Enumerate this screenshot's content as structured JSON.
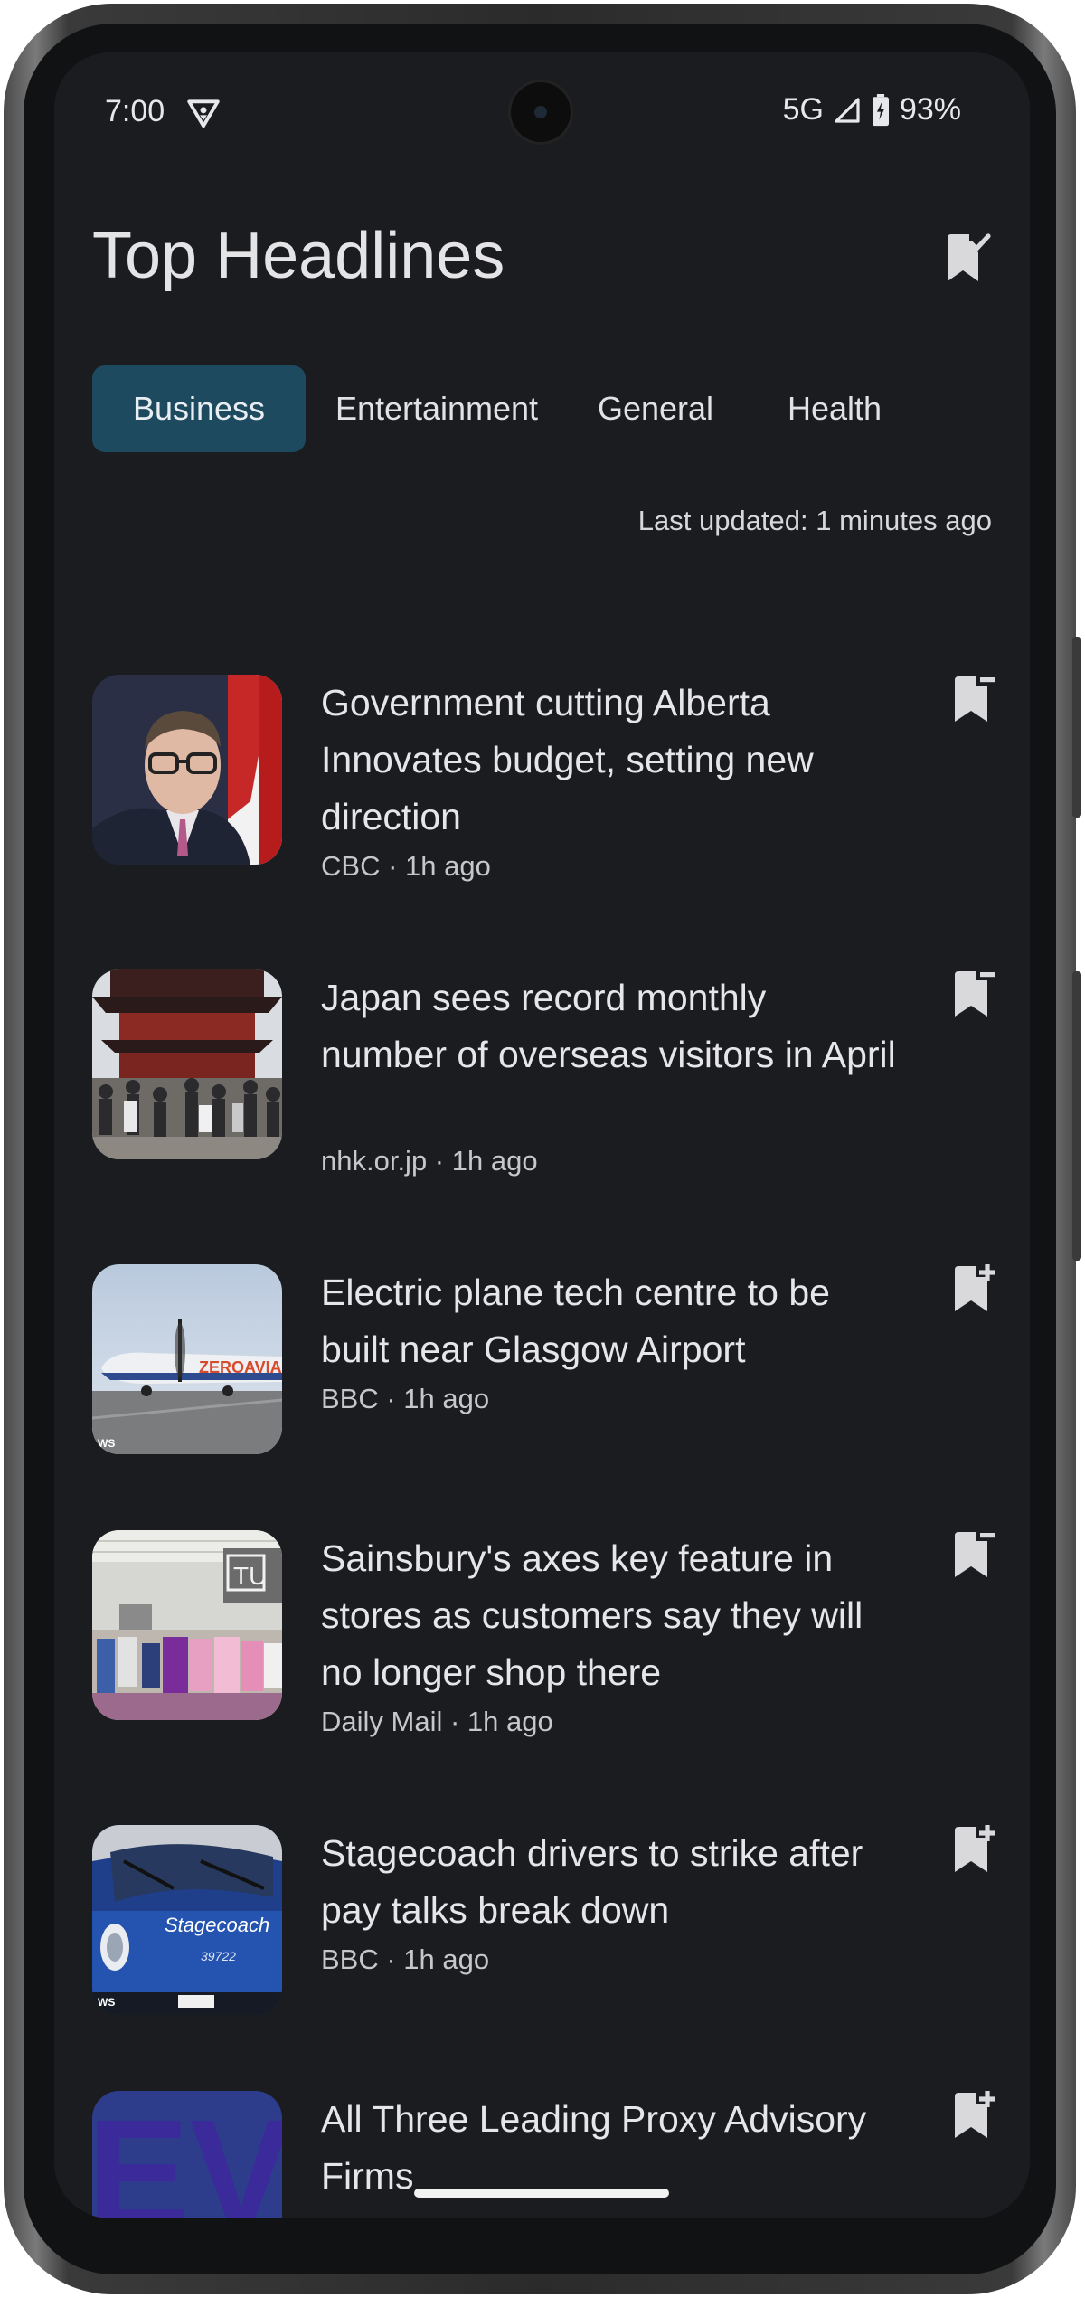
{
  "status_bar": {
    "time": "7:00",
    "network": "5G",
    "battery": "93%",
    "icons": [
      "vpn-icon",
      "signal-icon",
      "battery-charging-icon"
    ]
  },
  "header": {
    "title": "Top Headlines",
    "saved_icon": "bookmark-check-icon"
  },
  "tabs": [
    {
      "label": "Business",
      "selected": true
    },
    {
      "label": "Entertainment",
      "selected": false
    },
    {
      "label": "General",
      "selected": false
    },
    {
      "label": "Health",
      "selected": false
    }
  ],
  "last_updated": "Last updated: 1 minutes ago",
  "articles": [
    {
      "title": "Government cutting Alberta Innovates budget, setting new direction",
      "source": "CBC",
      "time": "1h ago",
      "meta": "CBC · 1h ago",
      "bookmark_state": "saved",
      "thumbnail": "man-at-podium-photo"
    },
    {
      "title": "Japan sees record monthly number of overseas visitors in April",
      "source": "nhk.or.jp",
      "time": "1h ago",
      "meta": "nhk.or.jp · 1h ago",
      "bookmark_state": "saved",
      "thumbnail": "temple-crowd-photo"
    },
    {
      "title": "Electric plane tech centre to be built near Glasgow Airport",
      "source": "BBC",
      "time": "1h ago",
      "meta": "BBC · 1h ago",
      "bookmark_state": "add",
      "thumbnail": "zeroavia-plane-photo",
      "thumbnail_text": "ZEROAVIA",
      "watermark": "WS"
    },
    {
      "title": "Sainsbury's axes key feature in stores as customers say they will no longer shop there",
      "source": "Daily Mail",
      "time": "1h ago",
      "meta": "Daily Mail · 1h ago",
      "bookmark_state": "saved",
      "thumbnail": "clothing-store-photo",
      "thumbnail_text": "TU"
    },
    {
      "title": "Stagecoach drivers to strike after pay talks break down",
      "source": "BBC",
      "time": "1h ago",
      "meta": "BBC · 1h ago",
      "bookmark_state": "add",
      "thumbnail": "stagecoach-bus-photo",
      "thumbnail_text": "Stagecoach",
      "watermark": "WS"
    },
    {
      "title": "All Three Leading Proxy Advisory Firms",
      "bookmark_state": "add",
      "thumbnail": "ev-logo-graphic",
      "thumbnail_text": "EV"
    }
  ],
  "colors": {
    "background": "#1b1c1f",
    "selected_tab": "#1d4a5f",
    "text_primary": "#e6e6e9",
    "text_secondary": "#c7c7cb"
  }
}
